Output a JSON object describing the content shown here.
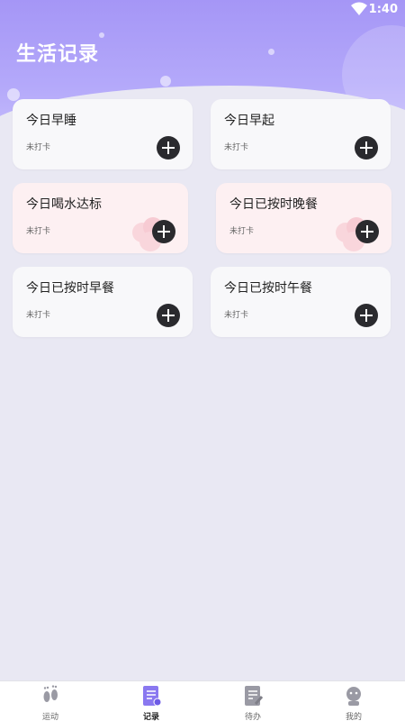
{
  "status_bar": {
    "time": "1:40"
  },
  "header": {
    "title": "生活记录"
  },
  "cards": [
    {
      "name": "今日早睡",
      "status": "未打卡",
      "style": "white"
    },
    {
      "name": "今日早起",
      "status": "未打卡",
      "style": "white"
    },
    {
      "name": "今日喝水达标",
      "status": "未打卡",
      "style": "pink"
    },
    {
      "name": "今日已按时晚餐",
      "status": "未打卡",
      "style": "pink"
    },
    {
      "name": "今日已按时早餐",
      "status": "未打卡",
      "style": "white"
    },
    {
      "name": "今日已按时午餐",
      "status": "未打卡",
      "style": "white"
    }
  ],
  "nav": {
    "items": [
      {
        "label": "运动",
        "icon": "footprints-icon"
      },
      {
        "label": "记录",
        "icon": "notes-icon",
        "active": true
      },
      {
        "label": "待办",
        "icon": "todo-icon"
      },
      {
        "label": "我的",
        "icon": "profile-icon"
      }
    ]
  },
  "colors": {
    "header_top": "#a596f6",
    "accent": "#8a78f0",
    "background": "#e9e8f3",
    "card": "#f8f8fa",
    "card_pink": "#fdf0f2",
    "add_button": "#2a2a2e"
  }
}
